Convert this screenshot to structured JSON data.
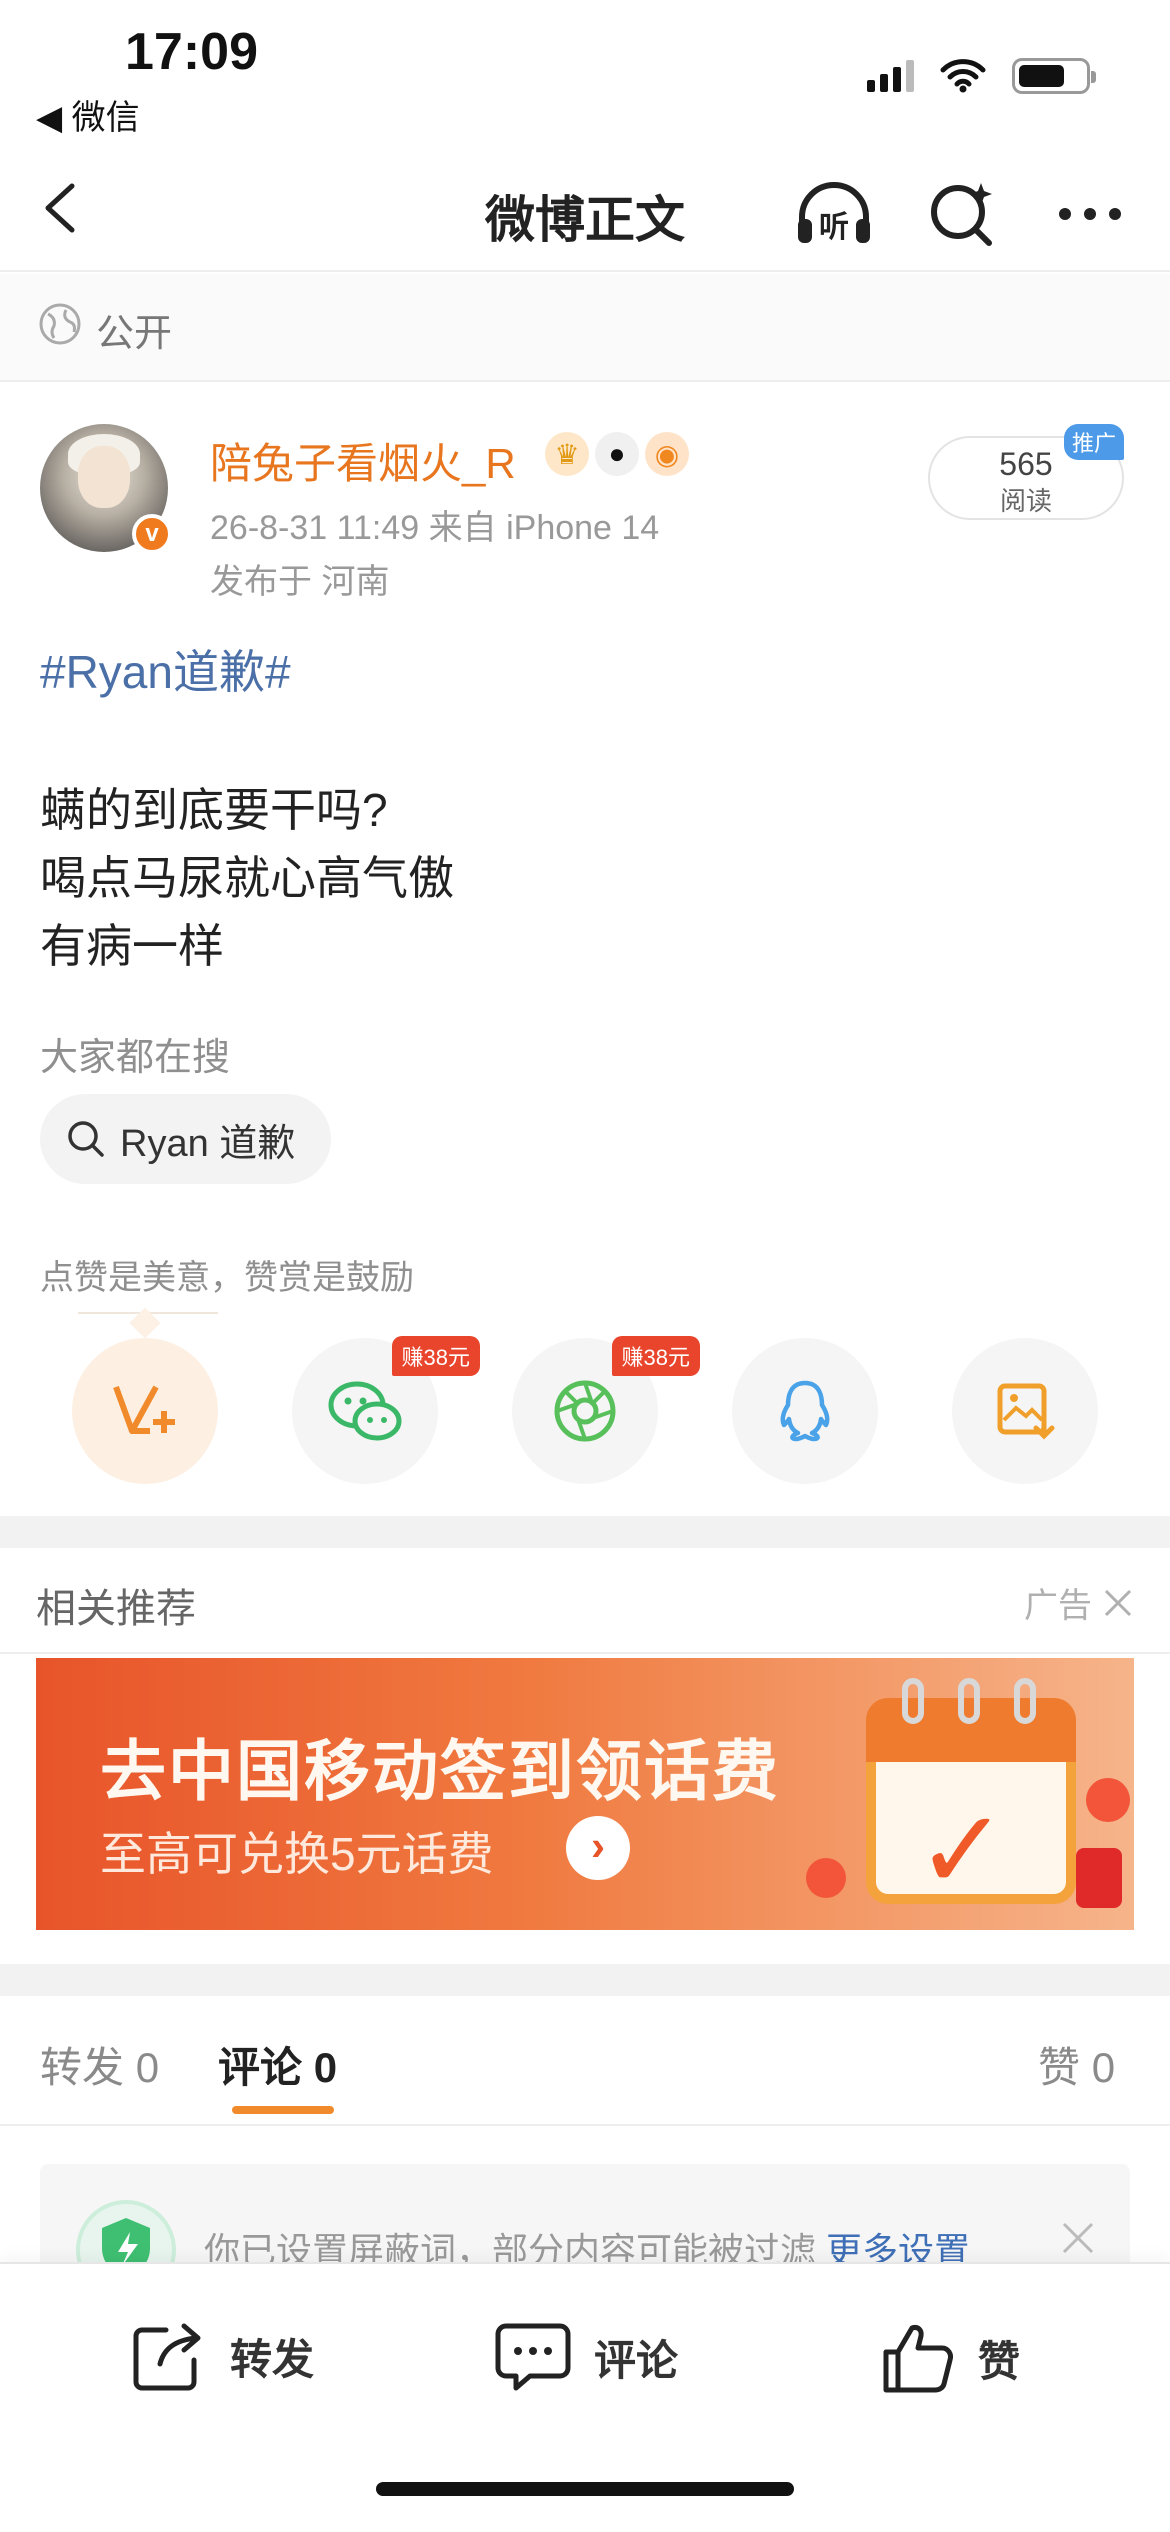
{
  "status_bar": {
    "time": "17:09",
    "back_app": "◀ 微信"
  },
  "navbar": {
    "title": "微博正文",
    "listen_label": "听"
  },
  "visibility": {
    "label": "公开"
  },
  "post": {
    "username": "陪兔子看烟火_R",
    "meta_time_source": "26-8-31 11:49  来自 iPhone 14",
    "meta_location": "发布于 河南",
    "reads_count": "565",
    "reads_label": "阅读",
    "promo_badge": "推广",
    "hashtag": "#Ryan道歉#",
    "body_lines": [
      "螨的到底要干吗?",
      "喝点马尿就心高气傲",
      "有病一样"
    ]
  },
  "hot_search": {
    "title": "大家都在搜",
    "query": "Ryan 道歉"
  },
  "reward": {
    "hint": "点赞是美意，赞赏是鼓励"
  },
  "share": {
    "wechat_earn": "赚38元",
    "moments_earn": "赚38元"
  },
  "related": {
    "title": "相关推荐",
    "ad_label": "广告"
  },
  "banner": {
    "headline": "去中国移动签到领话费",
    "subline": "至高可兑换5元话费",
    "go": "›"
  },
  "tabs": {
    "repost_label": "转发",
    "repost_count": "0",
    "comment_label": "评论",
    "comment_count": "0",
    "like_label": "赞",
    "like_count": "0"
  },
  "filter_notice": {
    "text": "你已设置屏蔽词，部分内容可能被过滤 ",
    "link": "更多设置"
  },
  "bottom_bar": {
    "repost": "转发",
    "comment": "评论",
    "like": "赞"
  },
  "colors": {
    "accent_orange": "#f08a2a",
    "username": "#e8761f",
    "link_blue": "#4b6fa7",
    "ad_red": "#e8452c"
  }
}
